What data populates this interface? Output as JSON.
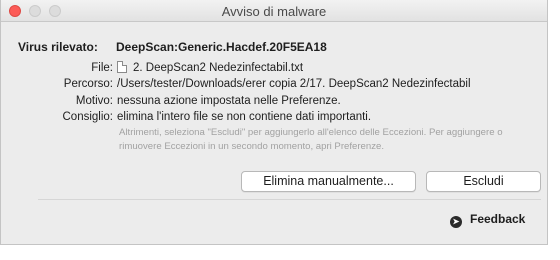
{
  "window": {
    "title": "Avviso di malware"
  },
  "virus": {
    "label": "Virus rilevato:",
    "name": "DeepScan:Generic.Hacdef.20F5EA18"
  },
  "details": {
    "file_label": "File:",
    "file_value": "2. DeepScan2 Nedezinfectabil.txt",
    "path_label": "Percorso:",
    "path_value": "/Users/tester/Downloads/erer copia 2/17. DeepScan2 Nedezinfectabil",
    "reason_label": "Motivo:",
    "reason_value": "nessuna azione impostata nelle Preferenze.",
    "advice_label": "Consiglio:",
    "advice_value": "elimina l'intero file se non contiene dati importanti.",
    "hint": "Altrimenti, seleziona \"Escludi\" per aggiungerlo all'elenco delle Eccezioni. Per aggiungere o rimuovere Eccezioni in un secondo momento, apri Preferenze."
  },
  "buttons": {
    "delete_manually": "Elimina manualmente...",
    "exclude": "Escludi"
  },
  "footer": {
    "feedback": "Feedback"
  },
  "icons": {
    "file": "document-icon",
    "feedback": "arrow-circle-icon"
  },
  "colors": {
    "close_button": "#fc5b57",
    "hint_text": "#a2a2a2",
    "window_bg": "#ececec"
  }
}
